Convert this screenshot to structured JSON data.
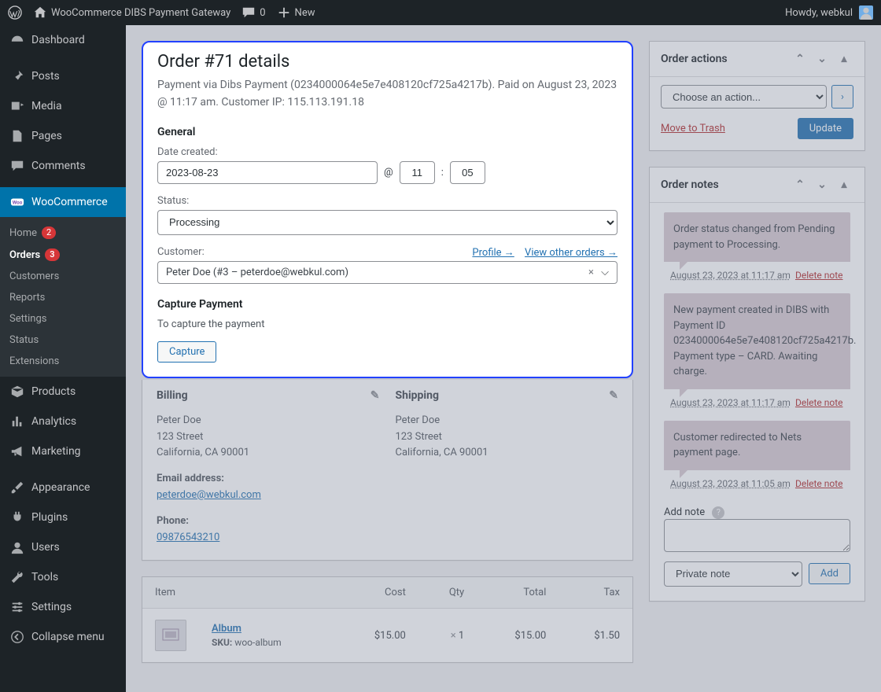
{
  "topbar": {
    "site_title": "WooCommerce DIBS Payment Gateway",
    "comment_count": "0",
    "new_label": "New",
    "greeting": "Howdy, webkul"
  },
  "sidebar": {
    "items": [
      {
        "label": "Dashboard"
      },
      {
        "label": "Posts"
      },
      {
        "label": "Media"
      },
      {
        "label": "Pages"
      },
      {
        "label": "Comments"
      },
      {
        "label": "WooCommerce"
      },
      {
        "label": "Products"
      },
      {
        "label": "Analytics"
      },
      {
        "label": "Marketing"
      },
      {
        "label": "Appearance"
      },
      {
        "label": "Plugins"
      },
      {
        "label": "Users"
      },
      {
        "label": "Tools"
      },
      {
        "label": "Settings"
      },
      {
        "label": "Collapse menu"
      }
    ],
    "submenu": [
      {
        "label": "Home",
        "badge": "2"
      },
      {
        "label": "Orders",
        "badge": "3"
      },
      {
        "label": "Customers"
      },
      {
        "label": "Reports"
      },
      {
        "label": "Settings"
      },
      {
        "label": "Status"
      },
      {
        "label": "Extensions"
      }
    ]
  },
  "order": {
    "title": "Order #71 details",
    "subtitle": "Payment via Dibs Payment (0234000064e5e7e408120cf725a4217b). Paid on August 23, 2023 @ 11:17 am. Customer IP: 115.113.191.18",
    "general_heading": "General",
    "date_label": "Date created:",
    "date_value": "2023-08-23",
    "at": "@",
    "hour": "11",
    "colon": ":",
    "minute": "05",
    "status_label": "Status:",
    "status_value": "Processing",
    "customer_label": "Customer:",
    "profile_link": "Profile →",
    "other_orders_link": "View other orders →",
    "customer_value": "Peter Doe (#3 – peterdoe@webkul.com)",
    "capture_heading": "Capture Payment",
    "capture_desc": "To capture the payment",
    "capture_btn": "Capture"
  },
  "billing": {
    "heading": "Billing",
    "name": "Peter Doe",
    "street": "123 Street",
    "city": "California, CA 90001",
    "email_label": "Email address:",
    "email": "peterdoe@webkul.com",
    "phone_label": "Phone:",
    "phone": "09876543210"
  },
  "shipping": {
    "heading": "Shipping",
    "name": "Peter Doe",
    "street": "123 Street",
    "city": "California, CA 90001"
  },
  "items": {
    "cols": {
      "item": "Item",
      "cost": "Cost",
      "qty": "Qty",
      "total": "Total",
      "tax": "Tax"
    },
    "rows": [
      {
        "name": "Album",
        "sku_label": "SKU:",
        "sku": "woo-album",
        "cost": "$15.00",
        "qty_prefix": "× ",
        "qty": "1",
        "total": "$15.00",
        "tax": "$1.50"
      }
    ]
  },
  "actions": {
    "title": "Order actions",
    "choose": "Choose an action...",
    "trash": "Move to Trash",
    "update": "Update"
  },
  "notes": {
    "title": "Order notes",
    "list": [
      {
        "text": "Order status changed from Pending payment to Processing.",
        "time": "August 23, 2023 at 11:17 am",
        "delete": "Delete note"
      },
      {
        "text": "New payment created in DIBS with Payment ID 0234000064e5e7e408120cf725a4217b. Payment type – CARD. Awaiting charge.",
        "time": "August 23, 2023 at 11:17 am",
        "delete": "Delete note"
      },
      {
        "text": "Customer redirected to Nets payment page.",
        "time": "August 23, 2023 at 11:05 am",
        "delete": "Delete note"
      }
    ],
    "add_label": "Add note",
    "note_type": "Private note",
    "add_btn": "Add"
  }
}
